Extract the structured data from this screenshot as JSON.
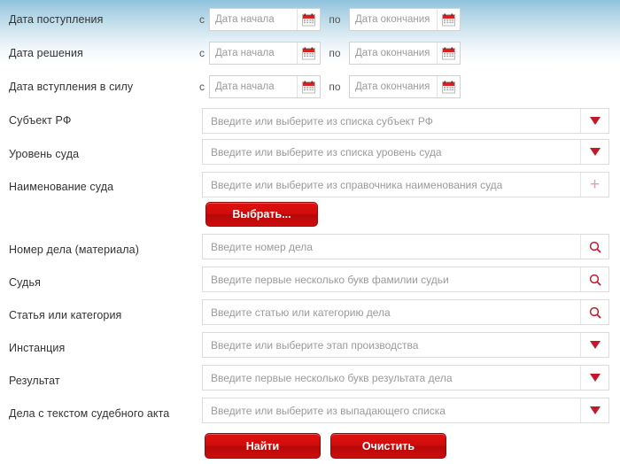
{
  "form": {
    "date_rows": [
      {
        "label": "Дата поступления",
        "from_conj": "с",
        "from_placeholder": "Дата начала",
        "to_conj": "по",
        "to_placeholder": "Дата окончания",
        "from_value": "",
        "to_value": ""
      },
      {
        "label": "Дата решения",
        "from_conj": "с",
        "from_placeholder": "Дата начала",
        "to_conj": "по",
        "to_placeholder": "Дата окончания",
        "from_value": "",
        "to_value": ""
      },
      {
        "label": "Дата вступления в силу",
        "from_conj": "с",
        "from_placeholder": "Дата начала",
        "to_conj": "по",
        "to_placeholder": "Дата окончания",
        "from_value": "",
        "to_value": ""
      }
    ],
    "fields": [
      {
        "label": "Субъект РФ",
        "placeholder": "Введите или выберите из списка субъект РФ",
        "value": "",
        "addon": "dropdown-caret-icon"
      },
      {
        "label": "Уровень суда",
        "placeholder": "Введите или выберите из списка уровень суда",
        "value": "",
        "addon": "dropdown-caret-icon"
      },
      {
        "label": "Наименование суда",
        "placeholder": "Введите или выберите из справочника наименования суда",
        "value": "",
        "addon": "plus-icon"
      },
      {
        "label": "Номер дела (материала)",
        "placeholder": "Введите номер дела",
        "value": "",
        "addon": "search-icon"
      },
      {
        "label": "Судья",
        "placeholder": "Введите первые несколько букв фамилии судьи",
        "value": "",
        "addon": "search-icon"
      },
      {
        "label": "Статья или категория",
        "placeholder": "Введите статью или категорию дела",
        "value": "",
        "addon": "search-icon"
      },
      {
        "label": "Инстанция",
        "placeholder": "Введите или выберите этап производства",
        "value": "",
        "addon": "dropdown-caret-icon"
      },
      {
        "label": "Результат",
        "placeholder": "Введите первые несколько букв результата дела",
        "value": "",
        "addon": "dropdown-caret-icon"
      },
      {
        "label": "Дела с текстом судебного акта",
        "placeholder": "Введите или выберите из выпадающего списка",
        "value": "",
        "addon": "dropdown-caret-icon"
      }
    ],
    "buttons": {
      "choose": "Выбрать...",
      "find": "Найти",
      "clear": "Очистить"
    }
  },
  "theme": {
    "accent_red": "#d00c0c",
    "caret_red": "#c2182a",
    "header_blue": "#8fc2dd",
    "label_color": "#333333",
    "placeholder_color": "#9a9a9a"
  },
  "icons": {
    "calendar": "calendar-icon",
    "caret": "dropdown-caret-icon",
    "search": "search-icon",
    "plus": "plus-icon"
  }
}
